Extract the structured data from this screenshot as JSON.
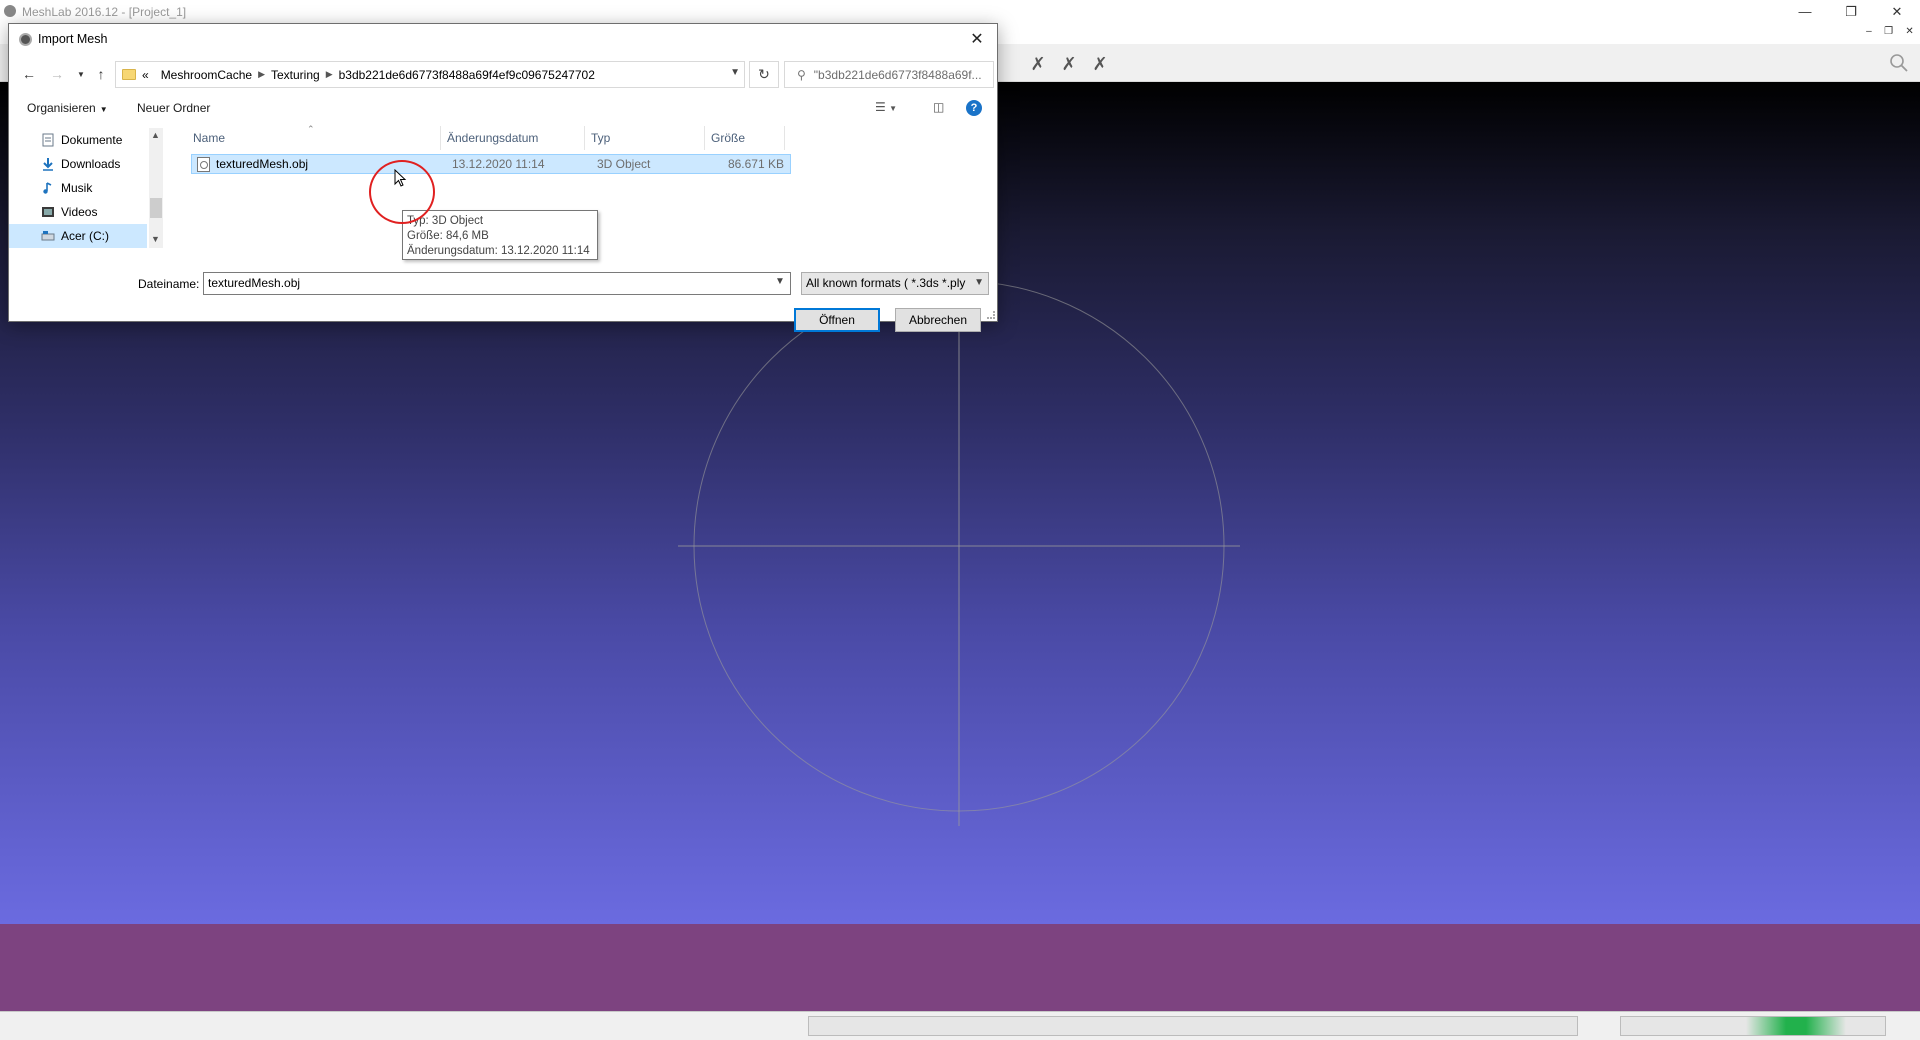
{
  "app": {
    "title": "MeshLab 2016.12 - [Project_1]",
    "window_controls": [
      "minimize-icon",
      "restore-icon",
      "close-icon"
    ]
  },
  "toolbar": {
    "visible_tools": [
      "measure-tool-icon",
      "pick-points-icon",
      "align-icon"
    ],
    "search_icon": "search-icon"
  },
  "viewport": {
    "background_top": "#000000",
    "background_bottom": "#6b6be0",
    "trackball_color": "#9a9a9a"
  },
  "bottom_band_color": "#7d4380",
  "dialog": {
    "title": "Import Mesh",
    "address": {
      "overflow": "«",
      "crumbs": [
        "MeshroomCache",
        "Texturing",
        "b3db221de6d6773f8488a69f4ef9c09675247702"
      ]
    },
    "search_placeholder": "\"b3db221de6d6773f8488a69f...",
    "commands": {
      "organize": "Organisieren",
      "new_folder": "Neuer Ordner"
    },
    "nav_items": [
      {
        "label": "Dokumente",
        "icon": "documents-icon"
      },
      {
        "label": "Downloads",
        "icon": "downloads-icon"
      },
      {
        "label": "Musik",
        "icon": "music-icon"
      },
      {
        "label": "Videos",
        "icon": "videos-icon"
      },
      {
        "label": "Acer (C:)",
        "icon": "drive-icon",
        "selected": true
      }
    ],
    "columns": [
      "Name",
      "Änderungsdatum",
      "Typ",
      "Größe"
    ],
    "files": [
      {
        "name": "texturedMesh.obj",
        "date": "13.12.2020 11:14",
        "type": "3D Object",
        "size": "86.671 KB",
        "selected": true
      }
    ],
    "tooltip": {
      "line1": "Typ: 3D Object",
      "line2": "Größe: 84,6 MB",
      "line3": "Änderungsdatum: 13.12.2020 11:14"
    },
    "filename_label": "Dateiname:",
    "filename_value": "texturedMesh.obj",
    "filter_value": "All known formats ( *.3ds *.ply",
    "open_button": "Öffnen",
    "cancel_button": "Abbrechen"
  }
}
